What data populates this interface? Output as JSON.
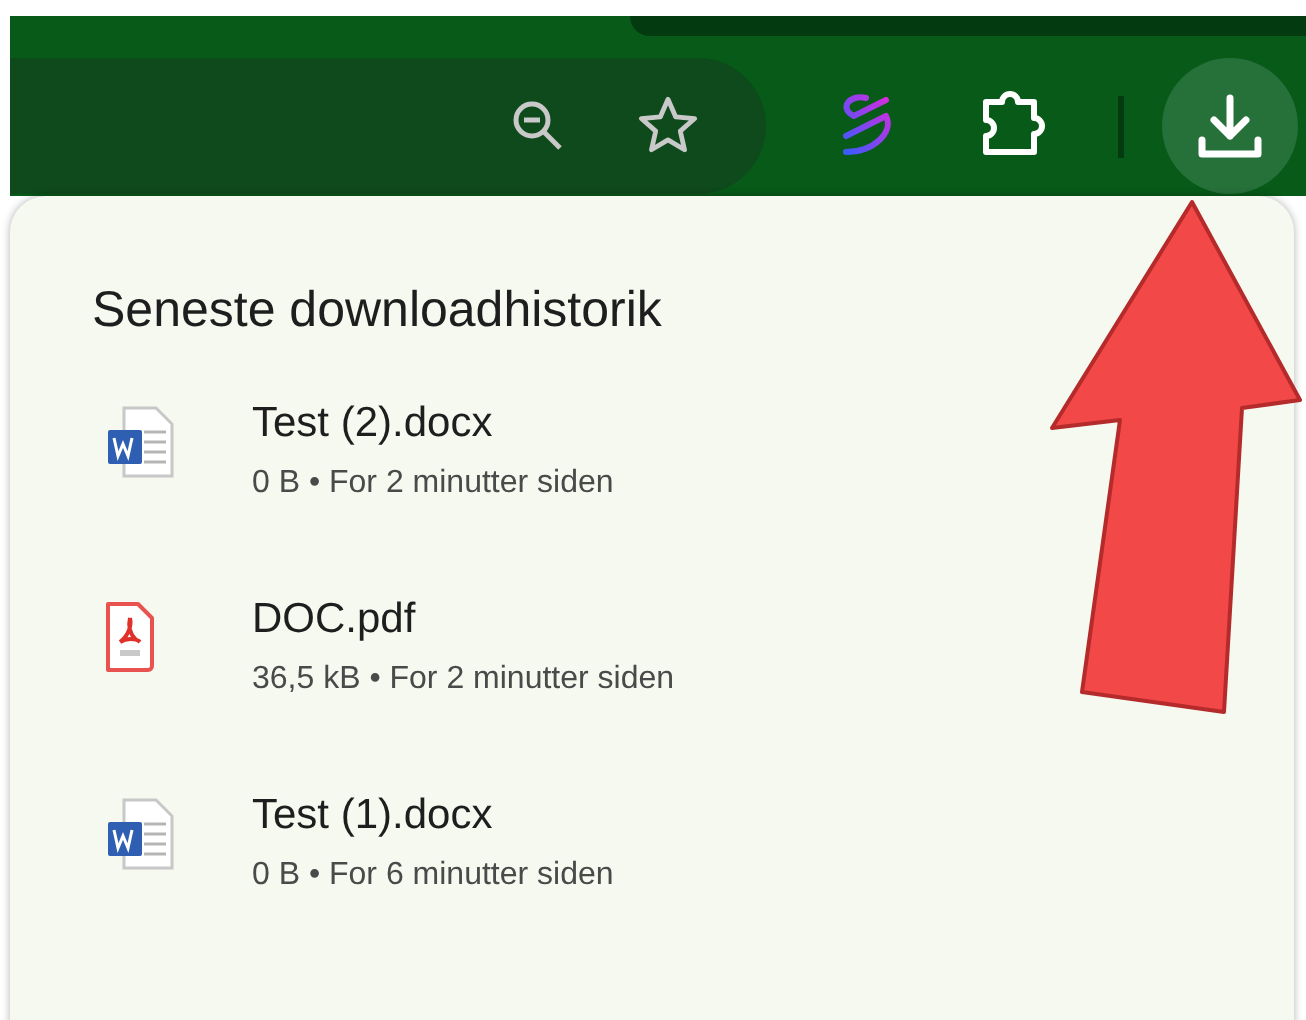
{
  "downloads_panel": {
    "title": "Seneste downloadhistorik",
    "items": [
      {
        "kind": "word",
        "name": "Test (2).docx",
        "detail": "0 B • For 2 minutter siden"
      },
      {
        "kind": "pdf",
        "name": "DOC.pdf",
        "detail": "36,5 kB • For 2 minutter siden"
      },
      {
        "kind": "word",
        "name": "Test (1).docx",
        "detail": "0 B • For 6 minutter siden"
      }
    ]
  }
}
